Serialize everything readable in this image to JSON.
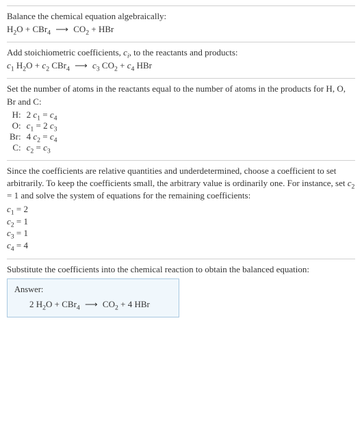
{
  "s1": {
    "intro": "Balance the chemical equation algebraically:",
    "eq_h2o": "H",
    "eq_plus1": " + CBr",
    "eq_co2": "CO",
    "eq_hbr": " + HBr"
  },
  "s2": {
    "intro_a": "Add stoichiometric coefficients, ",
    "ci": "c",
    "intro_b": ", to the reactants and products:",
    "c1": "c",
    "c2": "c",
    "c3": "c",
    "c4": "c",
    "h2o": " H",
    "o_plus": "O + ",
    "cbr": " CBr",
    "co2": " CO",
    "plus": " + ",
    "hbr": " HBr"
  },
  "s3": {
    "intro": "Set the number of atoms in the reactants equal to the number of atoms in the products for H, O, Br and C:",
    "rows": [
      {
        "el": "H:",
        "eq_a": "2 ",
        "c": "c",
        "s1": "1",
        "eqs": " = ",
        "c2": "c",
        "s2": "4"
      },
      {
        "el": "O:",
        "eq_a": "",
        "c": "c",
        "s1": "1",
        "eqs": " = 2 ",
        "c2": "c",
        "s2": "3"
      },
      {
        "el": "Br:",
        "eq_a": "4 ",
        "c": "c",
        "s1": "2",
        "eqs": " = ",
        "c2": "c",
        "s2": "4"
      },
      {
        "el": "C:",
        "eq_a": "",
        "c": "c",
        "s1": "2",
        "eqs": " = ",
        "c2": "c",
        "s2": "3"
      }
    ]
  },
  "s4": {
    "intro_a": "Since the coefficients are relative quantities and underdetermined, choose a coefficient to set arbitrarily. To keep the coefficients small, the arbitrary value is ordinarily one. For instance, set ",
    "c2": "c",
    "intro_b": " = 1 and solve the system of equations for the remaining coefficients:",
    "coefs": [
      {
        "c": "c",
        "s": "1",
        "v": " = 2"
      },
      {
        "c": "c",
        "s": "2",
        "v": " = 1"
      },
      {
        "c": "c",
        "s": "3",
        "v": " = 1"
      },
      {
        "c": "c",
        "s": "4",
        "v": " = 4"
      }
    ]
  },
  "s5": {
    "intro": "Substitute the coefficients into the chemical reaction to obtain the balanced equation:",
    "answer_label": "Answer:",
    "eq_2h2o": "2 H",
    "eq_o_plus_cbr": "O + CBr",
    "eq_co2": "CO",
    "eq_4hbr": " + 4 HBr"
  }
}
